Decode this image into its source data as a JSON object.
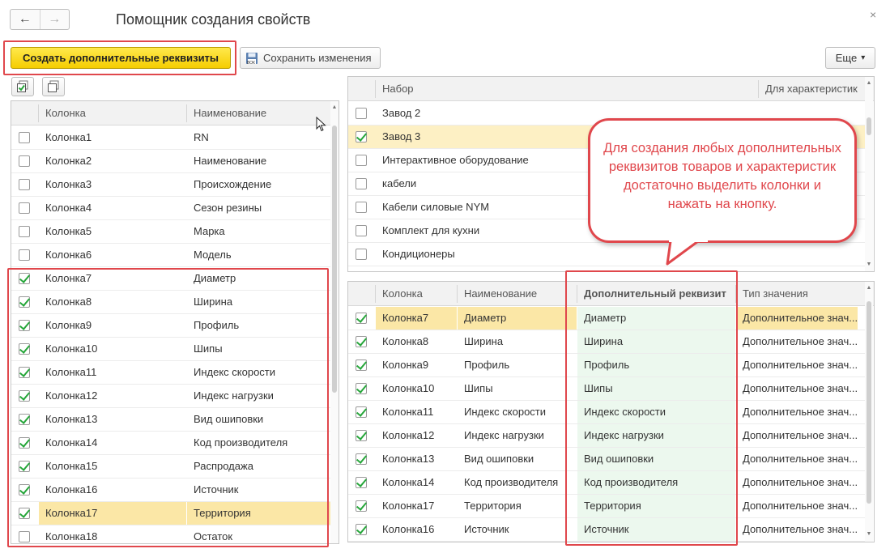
{
  "window": {
    "title": "Помощник создания свойств",
    "close_glyph": "×"
  },
  "nav": {
    "back": "←",
    "forward": "→"
  },
  "toolbar": {
    "create_label": "Создать дополнительные реквизиты",
    "save_label": "Сохранить изменения",
    "save_icon_text": "ВОК",
    "more_label": "Еще",
    "more_arrow": "▾"
  },
  "left_table": {
    "headers": [
      "Колонка",
      "Наименование"
    ],
    "rows": [
      {
        "checked": false,
        "col": "Колонка1",
        "name": "RN"
      },
      {
        "checked": false,
        "col": "Колонка2",
        "name": "Наименование"
      },
      {
        "checked": false,
        "col": "Колонка3",
        "name": "Происхождение"
      },
      {
        "checked": false,
        "col": "Колонка4",
        "name": "Сезон резины"
      },
      {
        "checked": false,
        "col": "Колонка5",
        "name": "Марка"
      },
      {
        "checked": false,
        "col": "Колонка6",
        "name": "Модель"
      },
      {
        "checked": true,
        "col": "Колонка7",
        "name": "Диаметр"
      },
      {
        "checked": true,
        "col": "Колонка8",
        "name": "Ширина"
      },
      {
        "checked": true,
        "col": "Колонка9",
        "name": "Профиль"
      },
      {
        "checked": true,
        "col": "Колонка10",
        "name": "Шипы"
      },
      {
        "checked": true,
        "col": "Колонка11",
        "name": "Индекс скорости"
      },
      {
        "checked": true,
        "col": "Колонка12",
        "name": "Индекс нагрузки"
      },
      {
        "checked": true,
        "col": "Колонка13",
        "name": "Вид ошиповки"
      },
      {
        "checked": true,
        "col": "Колонка14",
        "name": "Код производителя"
      },
      {
        "checked": true,
        "col": "Колонка15",
        "name": "Распродажа"
      },
      {
        "checked": true,
        "col": "Колонка16",
        "name": "Источник"
      },
      {
        "checked": true,
        "col": "Колонка17",
        "name": "Территория",
        "selected": true
      },
      {
        "checked": false,
        "col": "Колонка18",
        "name": "Остаток"
      }
    ]
  },
  "sets_table": {
    "headers": [
      "Набор",
      "Для характеристик"
    ],
    "rows": [
      {
        "checked": false,
        "name": "Завод 2"
      },
      {
        "checked": true,
        "name": "Завод 3",
        "selected": true
      },
      {
        "checked": false,
        "name": "Интерактивное оборудование"
      },
      {
        "checked": false,
        "name": "кабели"
      },
      {
        "checked": false,
        "name": "Кабели силовые NYM"
      },
      {
        "checked": false,
        "name": "Комплект для кухни"
      },
      {
        "checked": false,
        "name": "Кондиционеры"
      }
    ]
  },
  "mapping_table": {
    "headers": [
      "Колонка",
      "Наименование",
      "Дополнительный реквизит",
      "Тип значения"
    ],
    "rows": [
      {
        "checked": true,
        "col": "Колонка7",
        "name": "Диаметр",
        "attr": "Диаметр",
        "type": "Дополнительное знач...",
        "selected": true
      },
      {
        "checked": true,
        "col": "Колонка8",
        "name": "Ширина",
        "attr": "Ширина",
        "type": "Дополнительное знач..."
      },
      {
        "checked": true,
        "col": "Колонка9",
        "name": "Профиль",
        "attr": "Профиль",
        "type": "Дополнительное знач..."
      },
      {
        "checked": true,
        "col": "Колонка10",
        "name": "Шипы",
        "attr": "Шипы",
        "type": "Дополнительное знач..."
      },
      {
        "checked": true,
        "col": "Колонка11",
        "name": "Индекс скорости",
        "attr": "Индекс скорости",
        "type": "Дополнительное знач..."
      },
      {
        "checked": true,
        "col": "Колонка12",
        "name": "Индекс нагрузки",
        "attr": "Индекс нагрузки",
        "type": "Дополнительное знач..."
      },
      {
        "checked": true,
        "col": "Колонка13",
        "name": "Вид ошиповки",
        "attr": "Вид ошиповки",
        "type": "Дополнительное знач..."
      },
      {
        "checked": true,
        "col": "Колонка14",
        "name": "Код производителя",
        "attr": "Код производителя",
        "type": "Дополнительное знач..."
      },
      {
        "checked": true,
        "col": "Колонка17",
        "name": "Территория",
        "attr": "Территория",
        "type": "Дополнительное знач..."
      },
      {
        "checked": true,
        "col": "Колонка16",
        "name": "Источник",
        "attr": "Источник",
        "type": "Дополнительное знач..."
      }
    ]
  },
  "callout": {
    "text": "Для создания любых дополнительных реквизитов товаров и характеристик достаточно выделить колонки и нажать на кнопку."
  },
  "colors": {
    "accent_red": "#e0474c",
    "check_green": "#26a63a",
    "button_yellow": "#f5cd00"
  }
}
